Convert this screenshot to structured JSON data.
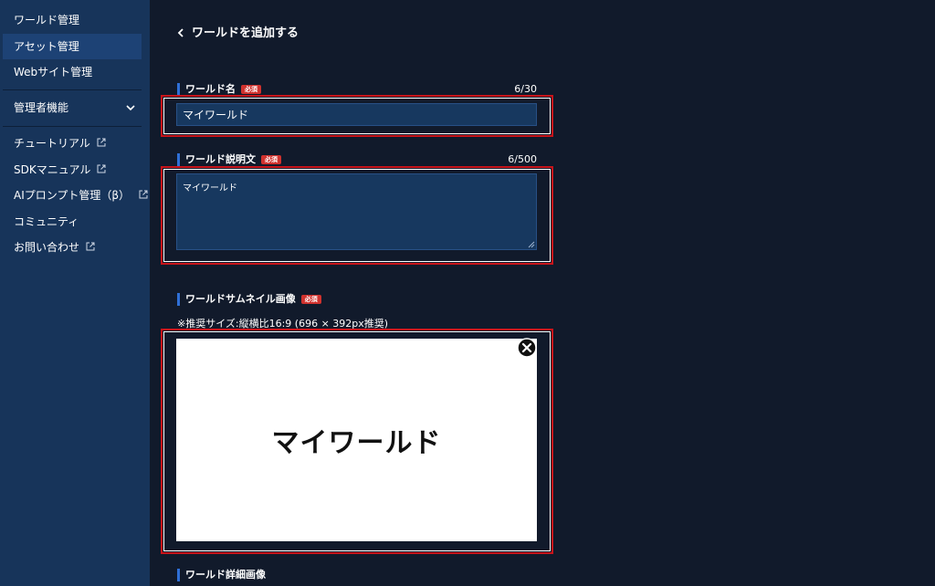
{
  "sidebar": {
    "items": [
      {
        "label": "ワールド管理"
      },
      {
        "label": "アセット管理"
      },
      {
        "label": "Webサイト管理"
      }
    ],
    "admin": {
      "label": "管理者機能"
    },
    "links": [
      {
        "label": "チュートリアル"
      },
      {
        "label": "SDKマニュアル"
      },
      {
        "label": "AIプロンプト管理（β）"
      },
      {
        "label": "コミュニティ"
      },
      {
        "label": "お問い合わせ"
      }
    ]
  },
  "header": {
    "back_label": "ワールドを追加する"
  },
  "form": {
    "required_badge": "必須",
    "name": {
      "label": "ワールド名",
      "counter": "6/30",
      "value": "マイワールド"
    },
    "description": {
      "label": "ワールド説明文",
      "counter": "6/500",
      "value": "マイワールド"
    },
    "thumbnail": {
      "label": "ワールドサムネイル画像",
      "note": "※推奨サイズ:縦横比16:9 (696 × 392px推奨)",
      "preview_text": "マイワールド"
    },
    "detail_image": {
      "label": "ワールド詳細画像"
    }
  },
  "colors": {
    "accent": "#2f6fd6",
    "required": "#d0322e",
    "highlight": "#c8141a",
    "sidebar": "#17345a",
    "background": "#111a2b"
  }
}
